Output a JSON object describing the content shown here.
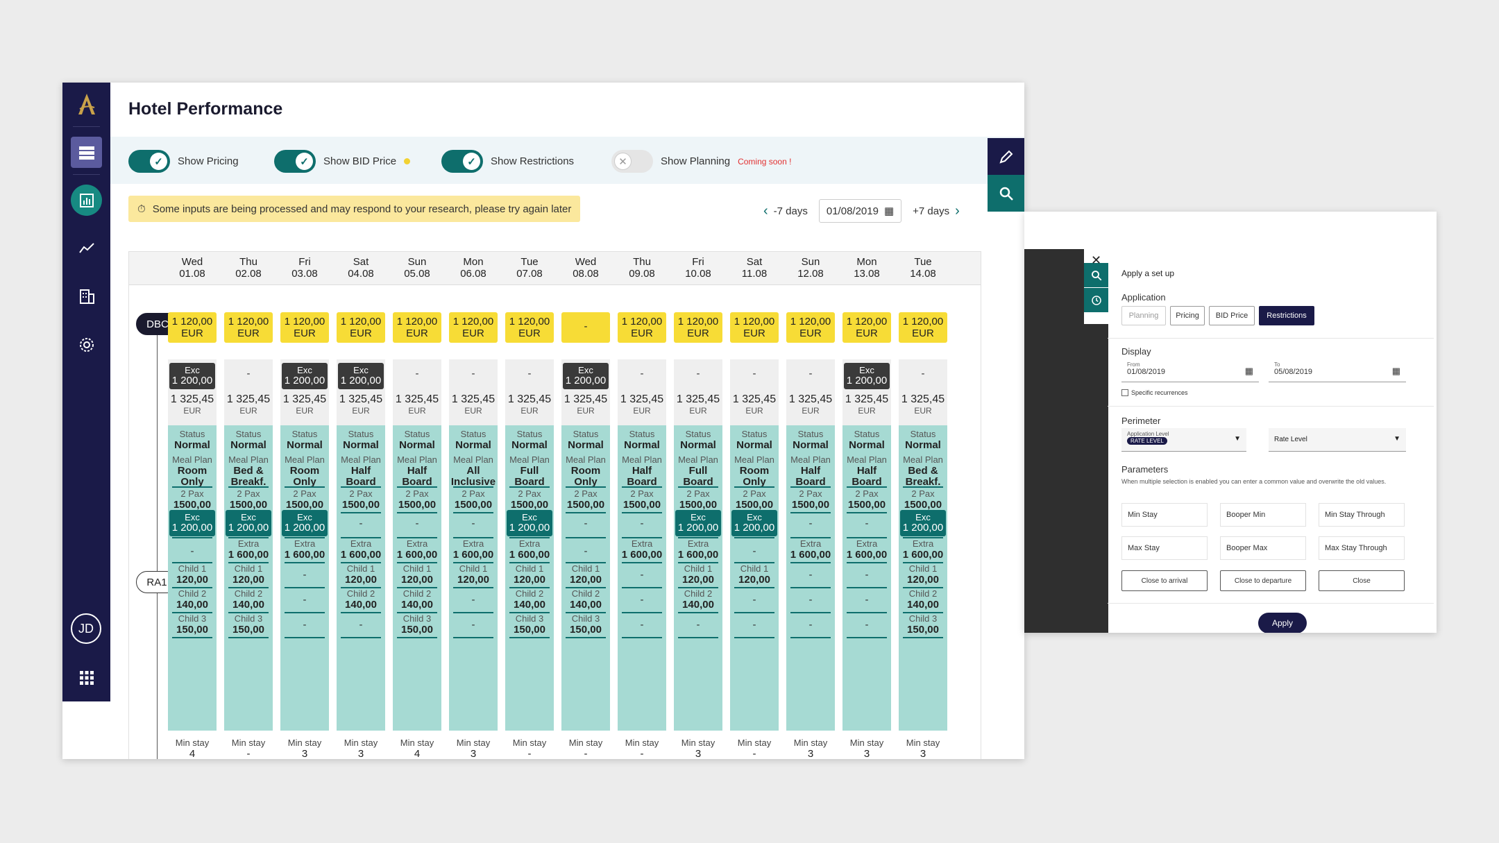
{
  "app": {
    "title": "Hotel Performance",
    "avatar_initials": "JD"
  },
  "toggles": [
    {
      "label": "Show Pricing",
      "on": true
    },
    {
      "label": "Show BID Price",
      "on": true
    },
    {
      "label": "Show Restrictions",
      "on": true
    },
    {
      "label": "Show Planning",
      "on": false,
      "note": "Coming soon !"
    }
  ],
  "warning": "Some inputs are being processed and may respond to your research, please try again later",
  "datenav": {
    "prev": "-7 days",
    "date": "01/08/2019",
    "next": "+7 days"
  },
  "rows": {
    "dbc": "DBC",
    "ra1": "RA1"
  },
  "days": [
    {
      "day": "Wed",
      "date": "01.08",
      "dbc": "1 120,00",
      "exc": true,
      "meal": "Room|Only",
      "exc2": true,
      "extra": false,
      "c1": "120,00",
      "c2": "140,00",
      "c3": "150,00",
      "ms": "4"
    },
    {
      "day": "Thu",
      "date": "02.08",
      "dbc": "1 120,00",
      "exc": false,
      "meal": "Bed &|Breakf.",
      "exc2": true,
      "extra": true,
      "c1": "120,00",
      "c2": "140,00",
      "c3": "150,00",
      "ms": "-"
    },
    {
      "day": "Fri",
      "date": "03.08",
      "dbc": "1 120,00",
      "exc": true,
      "meal": "Room|Only",
      "exc2": true,
      "extra": true,
      "c1": "-",
      "c2": "-",
      "c3": "-",
      "ms": "3"
    },
    {
      "day": "Sat",
      "date": "04.08",
      "dbc": "1 120,00",
      "exc": true,
      "meal": "Half|Board",
      "exc2": false,
      "extra": true,
      "c1": "120,00",
      "c2": "140,00",
      "c3": "-",
      "ms": "3"
    },
    {
      "day": "Sun",
      "date": "05.08",
      "dbc": "1 120,00",
      "exc": false,
      "meal": "Half|Board",
      "exc2": false,
      "extra": true,
      "c1": "120,00",
      "c2": "140,00",
      "c3": "150,00",
      "ms": "4"
    },
    {
      "day": "Mon",
      "date": "06.08",
      "dbc": "1 120,00",
      "exc": false,
      "meal": "All|Inclusive",
      "exc2": false,
      "extra": true,
      "c1": "120,00",
      "c2": "-",
      "c3": "-",
      "ms": "3"
    },
    {
      "day": "Tue",
      "date": "07.08",
      "dbc": "1 120,00",
      "exc": false,
      "meal": "Full|Board",
      "exc2": true,
      "extra": true,
      "c1": "120,00",
      "c2": "140,00",
      "c3": "150,00",
      "ms": "-"
    },
    {
      "day": "Wed",
      "date": "08.08",
      "dbc": "-",
      "exc": true,
      "meal": "Room|Only",
      "exc2": false,
      "extra": false,
      "c1": "120,00",
      "c2": "140,00",
      "c3": "150,00",
      "ms": "-"
    },
    {
      "day": "Thu",
      "date": "09.08",
      "dbc": "1 120,00",
      "exc": false,
      "meal": "Half|Board",
      "exc2": false,
      "extra": true,
      "c1": "-",
      "c2": "-",
      "c3": "-",
      "ms": "-"
    },
    {
      "day": "Fri",
      "date": "10.08",
      "dbc": "1 120,00",
      "exc": false,
      "meal": "Full|Board",
      "exc2": true,
      "extra": true,
      "c1": "120,00",
      "c2": "140,00",
      "c3": "-",
      "ms": "3"
    },
    {
      "day": "Sat",
      "date": "11.08",
      "dbc": "1 120,00",
      "exc": false,
      "meal": "Room|Only",
      "exc2": true,
      "extra": false,
      "c1": "120,00",
      "c2": "-",
      "c3": "-",
      "ms": "-"
    },
    {
      "day": "Sun",
      "date": "12.08",
      "dbc": "1 120,00",
      "exc": false,
      "meal": "Half|Board",
      "exc2": false,
      "extra": true,
      "c1": "-",
      "c2": "-",
      "c3": "-",
      "ms": "3"
    },
    {
      "day": "Mon",
      "date": "13.08",
      "dbc": "1 120,00",
      "exc": true,
      "meal": "Half|Board",
      "exc2": false,
      "extra": true,
      "c1": "-",
      "c2": "-",
      "c3": "-",
      "ms": "3"
    },
    {
      "day": "Tue",
      "date": "14.08",
      "dbc": "1 120,00",
      "exc": false,
      "meal": "Bed &|Breakf.",
      "exc2": true,
      "extra": true,
      "c1": "120,00",
      "c2": "140,00",
      "c3": "150,00",
      "ms": "3"
    }
  ],
  "labels": {
    "eur": "EUR",
    "exc": "Exc",
    "exc_val": "1 200,00",
    "price": "1 325,45",
    "status": "Status",
    "normal": "Normal",
    "meal_plan": "Meal Plan",
    "pax": "2 Pax",
    "pax_val": "1500,00",
    "extra": "Extra",
    "extra_val": "1 600,00",
    "child1": "Child 1",
    "child2": "Child 2",
    "child3": "Child 3",
    "min_stay": "Min stay",
    "dash": "-"
  },
  "panel": {
    "title": "Apply a set up",
    "application": "Application",
    "tabs": [
      "Planning",
      "Pricing",
      "BID Price",
      "Restrictions"
    ],
    "display": "Display",
    "from_label": "From",
    "from_value": "01/08/2019",
    "to_label": "To",
    "to_value": "05/08/2019",
    "specific": "Specific recurrences",
    "perimeter": "Perimeter",
    "app_level_label": "Application Level",
    "app_level_badge": "RATE LEVEL",
    "rate_level": "Rate Level",
    "parameters": "Parameters",
    "params_hint": "When multiple selection is enabled you can enter a common value and overwrite the old values.",
    "fields": [
      "Min Stay",
      "Booper Min",
      "Min Stay Through",
      "Max Stay",
      "Booper Max",
      "Max Stay Through"
    ],
    "buttons": [
      "Close to arrival",
      "Close to departure",
      "Close"
    ],
    "apply": "Apply"
  }
}
